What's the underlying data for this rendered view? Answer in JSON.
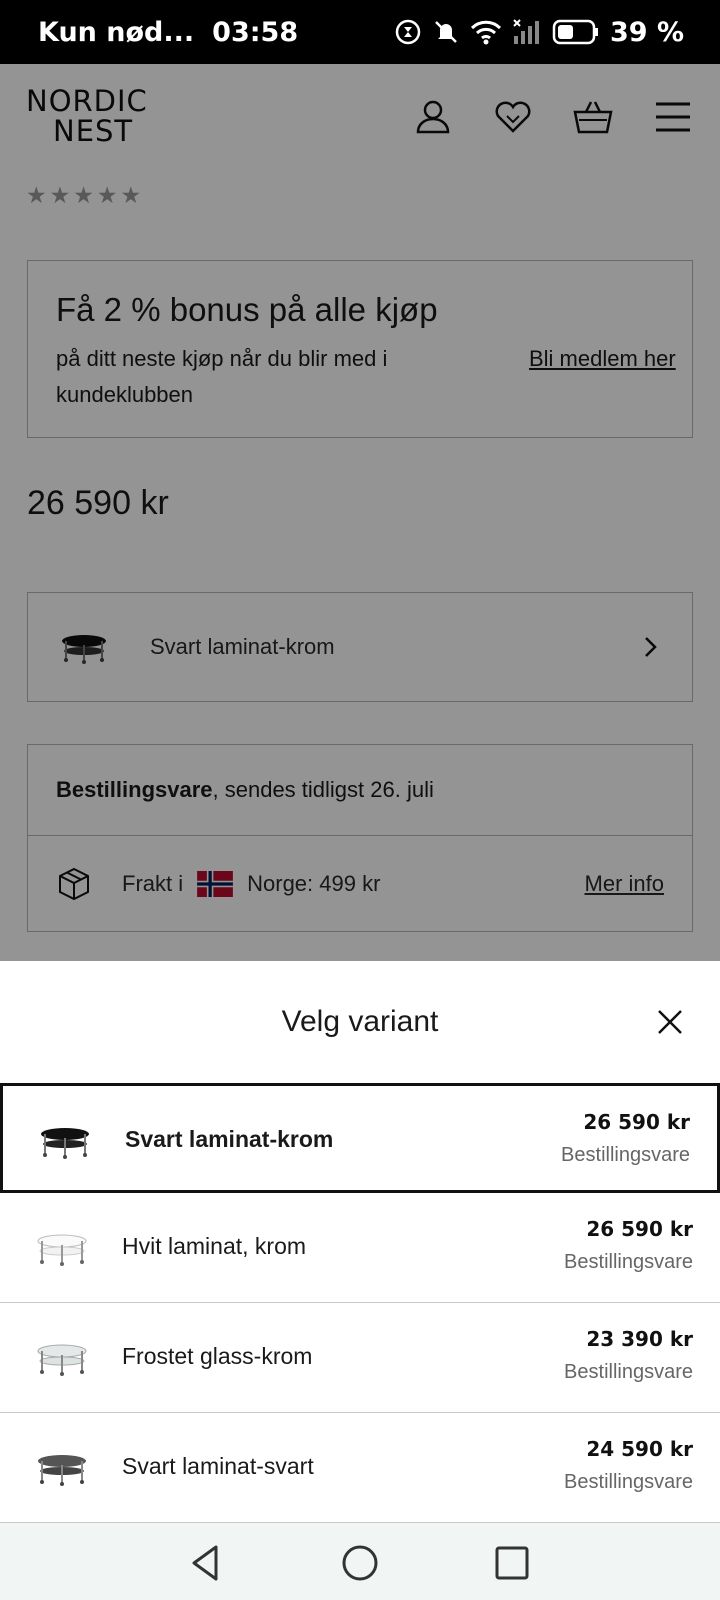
{
  "status_bar": {
    "carrier": "Kun nød...",
    "time": "03:58",
    "battery": "39 %"
  },
  "header": {
    "logo_line1": "NORDIC",
    "logo_line2": "NEST"
  },
  "rating": {
    "stars": "★★★★★"
  },
  "bonus": {
    "title": "Få 2 % bonus på alle kjøp",
    "subtitle": "på ditt neste kjøp når du blir med i kundeklubben",
    "link": "Bli medlem her"
  },
  "price": "26 590 kr",
  "variant_selector": {
    "label": "Svart laminat-krom"
  },
  "delivery": {
    "status_bold": "Bestillingsvare",
    "status_rest": ", sendes tidligst 26. juli",
    "shipping_prefix": "Frakt i",
    "shipping_suffix": "Norge: 499 kr",
    "more_info": "Mer info"
  },
  "sheet": {
    "title": "Velg variant",
    "options": [
      {
        "name": "Svart laminat-krom",
        "price": "26 590 kr",
        "status": "Bestillingsvare",
        "selected": true
      },
      {
        "name": "Hvit laminat, krom",
        "price": "26 590 kr",
        "status": "Bestillingsvare",
        "selected": false
      },
      {
        "name": "Frostet glass-krom",
        "price": "23 390 kr",
        "status": "Bestillingsvare",
        "selected": false
      },
      {
        "name": "Svart laminat-svart",
        "price": "24 590 kr",
        "status": "Bestillingsvare",
        "selected": false
      }
    ]
  },
  "colors": {
    "overlay": "#000000",
    "selected_border": "#111111",
    "nav_bg": "#f1f6f4"
  },
  "icons": [
    "hourglass-icon",
    "bell-off-icon",
    "wifi-icon",
    "signal-icon",
    "battery-icon",
    "user-icon",
    "heart-icon",
    "basket-icon",
    "menu-icon",
    "chevron-right-icon",
    "package-icon",
    "norway-flag-icon",
    "close-icon",
    "back-icon",
    "home-icon",
    "recents-icon"
  ]
}
